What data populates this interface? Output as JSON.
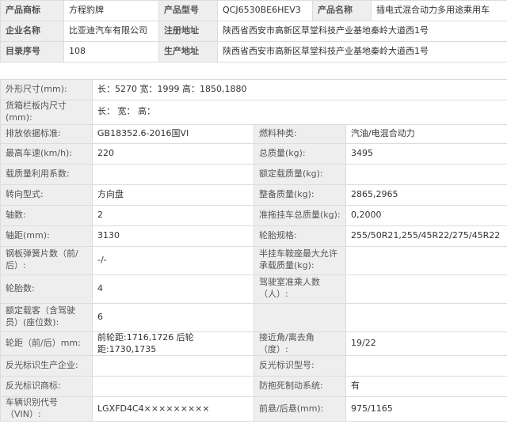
{
  "product": {
    "rows": [
      [
        {
          "k": "产品商标",
          "v": "方程豹牌"
        },
        {
          "k": "产品型号",
          "v": "QCJ6530BE6HEV3"
        },
        {
          "k": "产品名称",
          "v": "插电式混合动力多用途乘用车"
        }
      ],
      [
        {
          "k": "企业名称",
          "v": "比亚迪汽车有限公司"
        },
        {
          "k": "注册地址",
          "v": "陕西省西安市高新区草堂科技产业基地秦岭大道西1号"
        }
      ],
      [
        {
          "k": "目录序号",
          "v": "108"
        },
        {
          "k": "生产地址",
          "v": "陕西省西安市高新区草堂科技产业基地秦岭大道西1号"
        }
      ]
    ]
  },
  "specs": {
    "dimensions": {
      "k": "外形尺寸(mm):",
      "v": "长：5270 宽：1999 高：1850,1880"
    },
    "cargo_box": {
      "k": "货箱栏板内尺寸(mm):",
      "v": "长：  宽：  高："
    },
    "rows": [
      [
        {
          "k": "排放依据标准:",
          "v": "GB18352.6-2016国VI"
        },
        {
          "k": "燃料种类:",
          "v": "汽油/电混合动力"
        }
      ],
      [
        {
          "k": "最高车速(km/h):",
          "v": "220"
        },
        {
          "k": "总质量(kg):",
          "v": "3495"
        }
      ],
      [
        {
          "k": "载质量利用系数:",
          "v": ""
        },
        {
          "k": "额定载质量(kg):",
          "v": ""
        }
      ],
      [
        {
          "k": "转向型式:",
          "v": "方向盘"
        },
        {
          "k": "整备质量(kg):",
          "v": "2865,2965"
        }
      ],
      [
        {
          "k": "轴数:",
          "v": "2"
        },
        {
          "k": "准拖挂车总质量(kg):",
          "v": "0,2000"
        }
      ],
      [
        {
          "k": "轴距(mm):",
          "v": "3130"
        },
        {
          "k": "轮胎规格:",
          "v": "255/50R21,255/45R22/275/45R22"
        }
      ],
      [
        {
          "k": "钢板弹簧片数（前/后）:",
          "v": "-/-"
        },
        {
          "k": "半挂车鞍座最大允许承载质量(kg):",
          "v": ""
        }
      ],
      [
        {
          "k": "轮胎数:",
          "v": "4"
        },
        {
          "k": "驾驶室准乘人数（人）:",
          "v": ""
        }
      ],
      [
        {
          "k": "额定载客（含驾驶员）(座位数):",
          "v": "6"
        },
        {
          "k": "",
          "v": ""
        }
      ],
      [
        {
          "k": "轮距（前/后）mm:",
          "v": "前轮距:1716,1726 后轮距:1730,1735"
        },
        {
          "k": "接近角/离去角（度）:",
          "v": "19/22"
        }
      ],
      [
        {
          "k": "反光标识生产企业:",
          "v": ""
        },
        {
          "k": "反光标识型号:",
          "v": ""
        }
      ],
      [
        {
          "k": "反光标识商标:",
          "v": ""
        },
        {
          "k": "防抱死制动系统:",
          "v": "有"
        }
      ],
      [
        {
          "k": "车辆识别代号（VIN）:",
          "v": "LGXFD4C4×××××××××"
        },
        {
          "k": "前悬/后悬(mm):",
          "v": "975/1165"
        }
      ]
    ]
  }
}
